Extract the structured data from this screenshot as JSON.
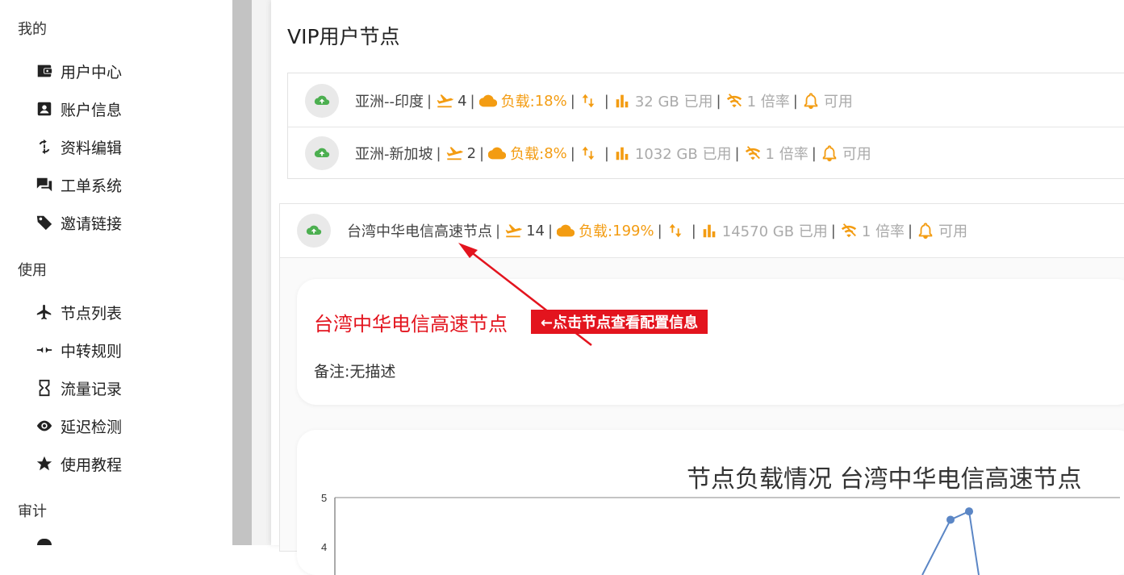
{
  "sidebar": {
    "sections": [
      {
        "title": "我的",
        "items": [
          {
            "label": "用户中心",
            "icon": "wallet-icon"
          },
          {
            "label": "账户信息",
            "icon": "account-box-icon"
          },
          {
            "label": "资料编辑",
            "icon": "sync-icon"
          },
          {
            "label": "工单系统",
            "icon": "forum-icon"
          },
          {
            "label": "邀请链接",
            "icon": "tag-icon"
          }
        ]
      },
      {
        "title": "使用",
        "items": [
          {
            "label": "节点列表",
            "icon": "airplane-icon"
          },
          {
            "label": "中转规则",
            "icon": "merge-arrows-icon"
          },
          {
            "label": "流量记录",
            "icon": "hourglass-icon"
          },
          {
            "label": "延迟检测",
            "icon": "eye-icon"
          },
          {
            "label": "使用教程",
            "icon": "star-icon"
          }
        ]
      },
      {
        "title": "审计",
        "items": []
      }
    ]
  },
  "main": {
    "title": "VIP用户节点",
    "nodes": [
      {
        "name": "亚洲--印度",
        "users": "4",
        "load_label": "负载:",
        "load": "18%",
        "traffic": "32 GB 已用",
        "rate": "1 倍率",
        "status": "可用"
      },
      {
        "name": "亚洲-新加坡",
        "users": "2",
        "load_label": "负载:",
        "load": "8%",
        "traffic": "1032 GB 已用",
        "rate": "1 倍率",
        "status": "可用"
      }
    ],
    "expanded_node": {
      "name": "台湾中华电信高速节点",
      "users": "14",
      "load_label": "负载:",
      "load": "199%",
      "traffic": "14570 GB 已用",
      "rate": "1 倍率",
      "status": "可用",
      "detail_title": "台湾中华电信高速节点",
      "tip": "←点击节点查看配置信息",
      "remark": "备注:无描述",
      "chart_title": "节点负载情况 台湾中华电信高速节点"
    },
    "separator": "|"
  },
  "chart_data": {
    "type": "line",
    "title": "节点负载情况 台湾中华电信高速节点",
    "y_ticks": [
      "5",
      "4"
    ],
    "ylim": [
      4,
      5
    ],
    "visible_points": [
      4.55,
      4.72
    ],
    "note": "only upper portion of chart visible"
  },
  "colors": {
    "accent_orange": "#f39c12",
    "red": "#e3141e",
    "green": "#4caf50",
    "line_blue": "#5b86c5"
  }
}
